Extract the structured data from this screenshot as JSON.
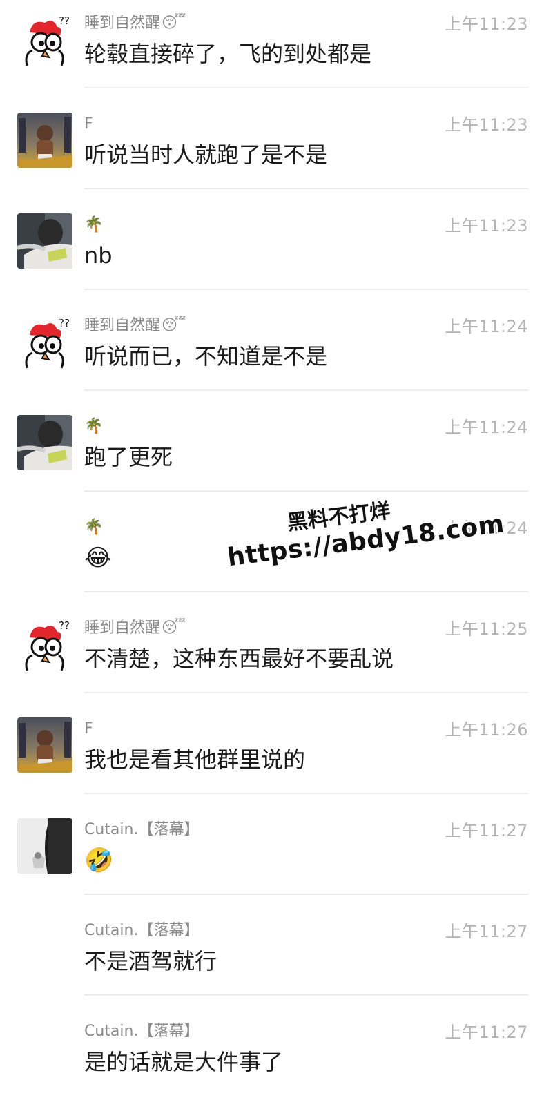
{
  "messages": [
    {
      "avatar": "rooster-avatar",
      "name": "睡到自然醒",
      "name_emoji": "😴",
      "time": "上午11:23",
      "text": "轮毂直接碎了，飞的到处都是"
    },
    {
      "avatar": "f-avatar",
      "name": "F",
      "name_emoji": "",
      "time": "上午11:23",
      "text": "听说当时人就跑了是不是"
    },
    {
      "avatar": "palm-user-avatar",
      "name": "",
      "name_emoji": "🌴",
      "time": "上午11:23",
      "text": "nb"
    },
    {
      "avatar": "rooster-avatar",
      "name": "睡到自然醒",
      "name_emoji": "😴",
      "time": "上午11:24",
      "text": "听说而已，不知道是不是"
    },
    {
      "avatar": "palm-user-avatar",
      "name": "",
      "name_emoji": "🌴",
      "time": "上午11:24",
      "text": "跑了更死"
    },
    {
      "avatar": "",
      "name": "",
      "name_emoji": "🌴",
      "time": "上午11:24",
      "text": "😂"
    },
    {
      "avatar": "rooster-avatar",
      "name": "睡到自然醒",
      "name_emoji": "😴",
      "time": "上午11:25",
      "text": "不清楚，这种东西最好不要乱说"
    },
    {
      "avatar": "f-avatar",
      "name": "F",
      "name_emoji": "",
      "time": "上午11:26",
      "text": "我也是看其他群里说的"
    },
    {
      "avatar": "cutain-avatar",
      "name": "Cutain.【落幕】",
      "name_emoji": "",
      "time": "上午11:27",
      "text": "🤣"
    },
    {
      "avatar": "",
      "name": "Cutain.【落幕】",
      "name_emoji": "",
      "time": "上午11:27",
      "text": "不是酒驾就行"
    },
    {
      "avatar": "",
      "name": "Cutain.【落幕】",
      "name_emoji": "",
      "time": "上午11:27",
      "text": "是的话就是大件事了"
    }
  ],
  "watermark": {
    "line1": "黑料不打烊",
    "line2": "https://abdy18.com"
  }
}
